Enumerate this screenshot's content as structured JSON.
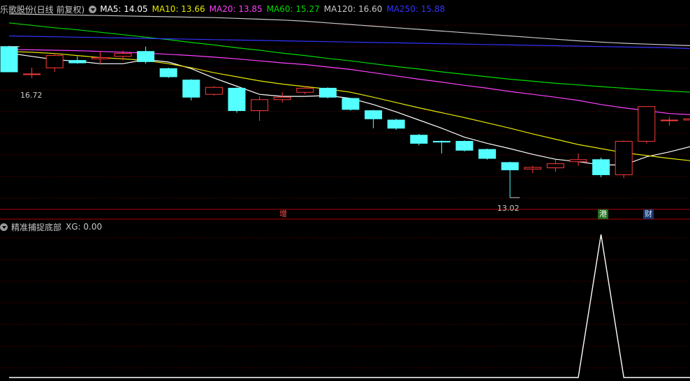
{
  "header": {
    "title": "乐歌股份(日线 前复权)",
    "ma": [
      {
        "label": "MA5: 14.05",
        "color": "#ffffff"
      },
      {
        "label": "MA10: 13.66",
        "color": "#e8e800"
      },
      {
        "label": "MA20: 13.85",
        "color": "#ff40ff"
      },
      {
        "label": "MA60: 15.27",
        "color": "#00dd00"
      },
      {
        "label": "MA120: 16.60",
        "color": "#c8c8c8"
      },
      {
        "label": "MA250: 15.88",
        "color": "#3333ff"
      }
    ]
  },
  "indicator": {
    "name": "精准捕捉底部",
    "value_label": "XG: 0.00"
  },
  "annotations": {
    "high_label": "16.72",
    "low_label": "13.02",
    "tags": [
      "增",
      "港",
      "财"
    ]
  },
  "colors": {
    "up": "#ff3b3b",
    "down": "#54ffff",
    "grid": "#7a0000",
    "axis": "#b00000"
  },
  "chart_data": [
    {
      "type": "candlestick",
      "title": "乐歌股份(日线 前复权)",
      "ylim": [
        12.75,
        17.45
      ],
      "candles": [
        {
          "o": 16.72,
          "h": 16.74,
          "l": 16.1,
          "c": 16.1
        },
        {
          "o": 16.05,
          "h": 16.2,
          "l": 15.95,
          "c": 16.05
        },
        {
          "o": 16.2,
          "h": 16.55,
          "l": 16.1,
          "c": 16.5
        },
        {
          "o": 16.38,
          "h": 16.48,
          "l": 16.3,
          "c": 16.32
        },
        {
          "o": 16.42,
          "h": 16.6,
          "l": 16.28,
          "c": 16.45
        },
        {
          "o": 16.48,
          "h": 16.62,
          "l": 16.38,
          "c": 16.55
        },
        {
          "o": 16.6,
          "h": 16.72,
          "l": 16.3,
          "c": 16.35
        },
        {
          "o": 16.18,
          "h": 16.2,
          "l": 15.95,
          "c": 15.98
        },
        {
          "o": 15.9,
          "h": 15.92,
          "l": 15.4,
          "c": 15.48
        },
        {
          "o": 15.55,
          "h": 15.75,
          "l": 15.52,
          "c": 15.72
        },
        {
          "o": 15.7,
          "h": 15.72,
          "l": 15.1,
          "c": 15.15
        },
        {
          "o": 15.15,
          "h": 15.5,
          "l": 14.9,
          "c": 15.42
        },
        {
          "o": 15.42,
          "h": 15.6,
          "l": 15.35,
          "c": 15.48
        },
        {
          "o": 15.6,
          "h": 15.75,
          "l": 15.55,
          "c": 15.7
        },
        {
          "o": 15.7,
          "h": 15.72,
          "l": 15.45,
          "c": 15.48
        },
        {
          "o": 15.45,
          "h": 15.46,
          "l": 15.15,
          "c": 15.18
        },
        {
          "o": 15.15,
          "h": 15.17,
          "l": 14.72,
          "c": 14.95
        },
        {
          "o": 14.92,
          "h": 14.95,
          "l": 14.68,
          "c": 14.72
        },
        {
          "o": 14.55,
          "h": 14.58,
          "l": 14.3,
          "c": 14.35
        },
        {
          "o": 14.4,
          "h": 14.42,
          "l": 14.1,
          "c": 14.38
        },
        {
          "o": 14.4,
          "h": 14.42,
          "l": 14.15,
          "c": 14.18
        },
        {
          "o": 14.2,
          "h": 14.22,
          "l": 13.95,
          "c": 13.98
        },
        {
          "o": 13.88,
          "h": 13.9,
          "l": 13.02,
          "c": 13.7
        },
        {
          "o": 13.72,
          "h": 13.8,
          "l": 13.62,
          "c": 13.76
        },
        {
          "o": 13.75,
          "h": 13.95,
          "l": 13.65,
          "c": 13.85
        },
        {
          "o": 13.9,
          "h": 14.1,
          "l": 13.8,
          "c": 13.95
        },
        {
          "o": 13.95,
          "h": 14.0,
          "l": 13.52,
          "c": 13.58
        },
        {
          "o": 13.58,
          "h": 14.42,
          "l": 13.5,
          "c": 14.4
        },
        {
          "o": 14.4,
          "h": 15.25,
          "l": 14.35,
          "c": 15.25
        },
        {
          "o": 14.92,
          "h": 15.0,
          "l": 14.78,
          "c": 14.92
        },
        {
          "o": 14.92,
          "h": 15.08,
          "l": 14.82,
          "c": 14.95
        }
      ],
      "series": [
        {
          "name": "MA5",
          "color": "#ffffff",
          "values": [
            16.56,
            16.48,
            16.4,
            16.36,
            16.3,
            16.3,
            16.4,
            16.34,
            16.18,
            15.95,
            15.75,
            15.55,
            15.5,
            15.5,
            15.52,
            15.45,
            15.3,
            15.12,
            14.92,
            14.72,
            14.5,
            14.35,
            14.22,
            14.08,
            13.96,
            13.9,
            13.82,
            13.82,
            14.02,
            14.14,
            14.28
          ]
        },
        {
          "name": "MA10",
          "color": "#e8e800",
          "values": [
            16.6,
            16.58,
            16.55,
            16.5,
            16.45,
            16.42,
            16.38,
            16.3,
            16.2,
            16.08,
            15.98,
            15.88,
            15.8,
            15.74,
            15.68,
            15.6,
            15.48,
            15.35,
            15.22,
            15.1,
            14.98,
            14.85,
            14.72,
            14.58,
            14.45,
            14.32,
            14.22,
            14.12,
            14.05,
            13.98,
            13.92
          ]
        },
        {
          "name": "MA20",
          "color": "#ff40ff",
          "values": [
            16.65,
            16.64,
            16.63,
            16.62,
            16.6,
            16.58,
            16.56,
            16.53,
            16.5,
            16.46,
            16.42,
            16.37,
            16.32,
            16.28,
            16.22,
            16.16,
            16.08,
            16.0,
            15.92,
            15.85,
            15.77,
            15.7,
            15.62,
            15.55,
            15.48,
            15.4,
            15.3,
            15.22,
            15.15,
            15.08,
            15.05
          ]
        },
        {
          "name": "MA60",
          "color": "#00dd00",
          "values": [
            17.3,
            17.24,
            17.18,
            17.13,
            17.07,
            17.01,
            16.95,
            16.89,
            16.82,
            16.76,
            16.69,
            16.63,
            16.56,
            16.5,
            16.43,
            16.37,
            16.3,
            16.23,
            16.17,
            16.1,
            16.04,
            15.98,
            15.92,
            15.87,
            15.82,
            15.78,
            15.74,
            15.7,
            15.66,
            15.63,
            15.6
          ]
        },
        {
          "name": "MA120",
          "color": "#c8c8c8",
          "values": [
            17.52,
            17.51,
            17.5,
            17.49,
            17.48,
            17.47,
            17.46,
            17.45,
            17.44,
            17.43,
            17.41,
            17.39,
            17.37,
            17.34,
            17.3,
            17.26,
            17.22,
            17.18,
            17.14,
            17.1,
            17.06,
            17.02,
            16.98,
            16.94,
            16.9,
            16.86,
            16.83,
            16.8,
            16.78,
            16.76,
            16.74
          ]
        },
        {
          "name": "MA250",
          "color": "#3333ff",
          "values": [
            16.98,
            16.97,
            16.96,
            16.95,
            16.94,
            16.93,
            16.92,
            16.91,
            16.9,
            16.89,
            16.88,
            16.87,
            16.86,
            16.85,
            16.84,
            16.83,
            16.82,
            16.81,
            16.8,
            16.79,
            16.78,
            16.77,
            16.76,
            16.75,
            16.74,
            16.73,
            16.72,
            16.71,
            16.7,
            16.69,
            16.67
          ]
        }
      ]
    },
    {
      "type": "line",
      "title": "精准捕捉底部",
      "ylim": [
        0,
        1
      ],
      "series": [
        {
          "name": "XG",
          "color": "#ffffff",
          "values": [
            0,
            0,
            0,
            0,
            0,
            0,
            0,
            0,
            0,
            0,
            0,
            0,
            0,
            0,
            0,
            0,
            0,
            0,
            0,
            0,
            0,
            0,
            0,
            0,
            0,
            0,
            1,
            0,
            0,
            0,
            0
          ]
        }
      ]
    }
  ]
}
